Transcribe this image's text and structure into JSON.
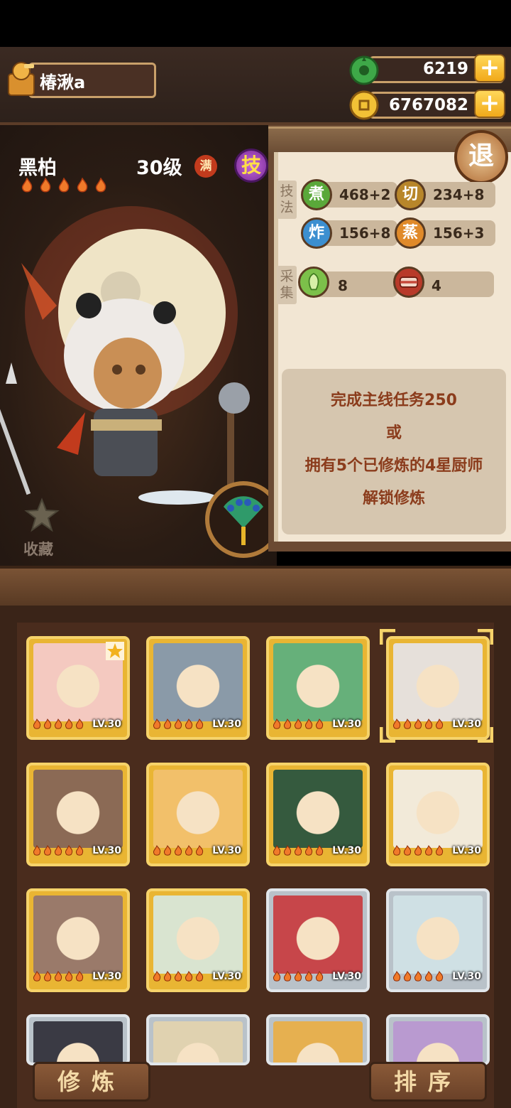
{
  "header": {
    "player_name": "椿湫a",
    "jade_amount": "6219",
    "gold_amount": "6767082",
    "plus_symbol": "+"
  },
  "chef": {
    "name": "黑柏",
    "level": "30级",
    "full_badge": "满",
    "skill_badge": "技",
    "stars": 5,
    "collect_label": "收藏"
  },
  "info": {
    "exit_label": "退",
    "technique_tag": "技法",
    "gather_tag": "采集",
    "techniques": [
      {
        "icon": "煮",
        "value": "468+2",
        "color": "#5aa83a"
      },
      {
        "icon": "切",
        "value": "234+8",
        "color": "#b8862a"
      },
      {
        "icon": "炸",
        "value": "156+8",
        "color": "#3c8fd0"
      },
      {
        "icon": "蒸",
        "value": "156+3",
        "color": "#e08a2a"
      }
    ],
    "gathers": [
      {
        "icon": "vegetable-icon",
        "value": "8",
        "color": "#7cc04a"
      },
      {
        "icon": "meat-icon",
        "value": "4",
        "color": "#b83a2a"
      }
    ],
    "unlock_lines": [
      "完成主线任务250",
      "或",
      "拥有5个已修炼的4星厨师",
      "解锁修炼"
    ]
  },
  "grid": {
    "cards": [
      {
        "level": "LV.30",
        "frame": "gold",
        "tone": "#f4c9c0",
        "starred": true
      },
      {
        "level": "LV.30",
        "frame": "gold",
        "tone": "#8a9aa8",
        "starred": false
      },
      {
        "level": "LV.30",
        "frame": "gold",
        "tone": "#66b07a",
        "starred": false
      },
      {
        "level": "LV.30",
        "frame": "gold",
        "tone": "#e6e0da",
        "starred": false,
        "selected": true
      },
      {
        "level": "LV.30",
        "frame": "gold",
        "tone": "#8b6a55",
        "starred": false
      },
      {
        "level": "LV.30",
        "frame": "gold",
        "tone": "#f2c06a",
        "starred": false
      },
      {
        "level": "LV.30",
        "frame": "gold",
        "tone": "#355a3e",
        "starred": false
      },
      {
        "level": "LV.30",
        "frame": "gold",
        "tone": "#f2ead9",
        "starred": false
      },
      {
        "level": "LV.30",
        "frame": "gold",
        "tone": "#9a7a6a",
        "starred": false
      },
      {
        "level": "LV.30",
        "frame": "gold",
        "tone": "#d9e4d0",
        "starred": false
      },
      {
        "level": "LV.30",
        "frame": "silver",
        "tone": "#c7464a",
        "starred": false
      },
      {
        "level": "LV.30",
        "frame": "silver",
        "tone": "#cfe0e4",
        "starred": false
      },
      {
        "level": "",
        "frame": "silver",
        "tone": "#3a3a44",
        "starred": false
      },
      {
        "level": "",
        "frame": "silver",
        "tone": "#e0d2b0",
        "starred": false
      },
      {
        "level": "",
        "frame": "silver",
        "tone": "#e6b050",
        "starred": false
      },
      {
        "level": "",
        "frame": "silver",
        "tone": "#b99ad0",
        "starred": false
      }
    ]
  },
  "bottom": {
    "cultivate_label": "修炼",
    "sort_label": "排序"
  }
}
